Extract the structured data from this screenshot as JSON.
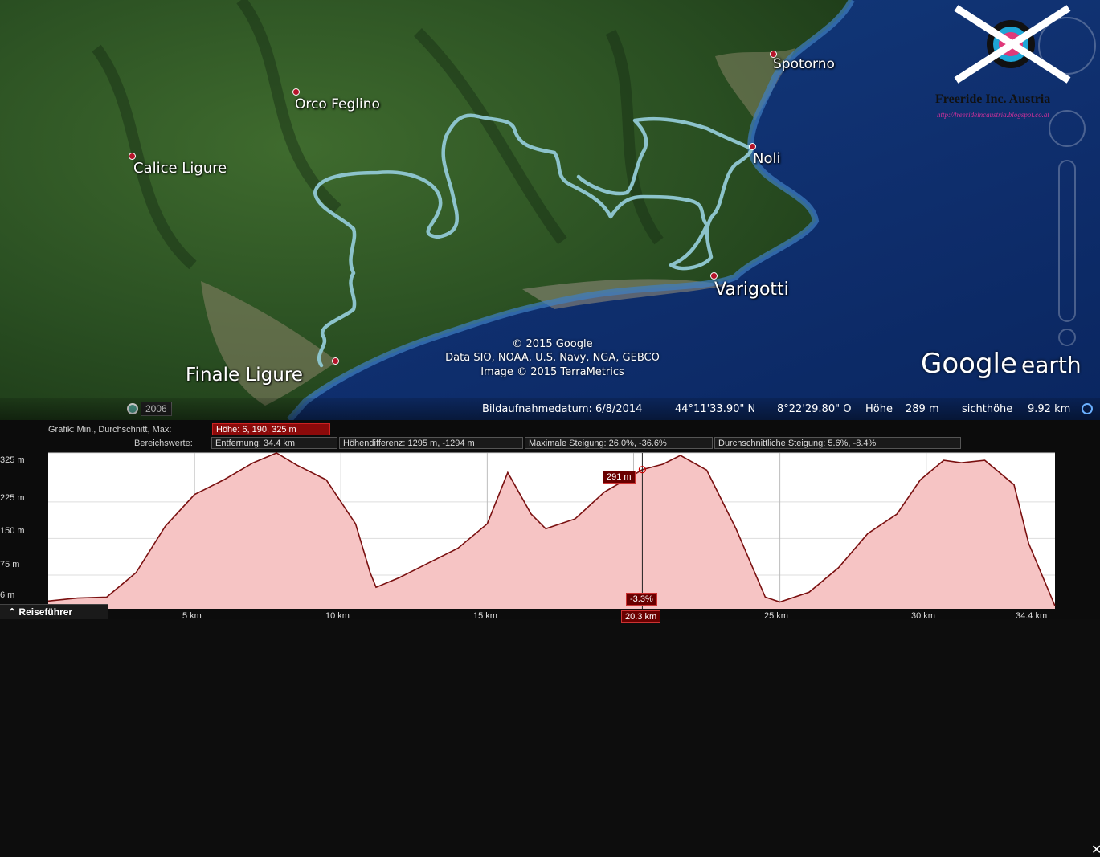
{
  "map": {
    "places": {
      "spotorno": "Spotorno",
      "orco": "Orco Feglino",
      "calice": "Calice Ligure",
      "noli": "Noli",
      "varigotti": "Varigotti",
      "finale": "Finale Ligure"
    },
    "credits": {
      "line1": "© 2015 Google",
      "line2": "Data SIO, NOAA, U.S. Navy, NGA, GEBCO",
      "line3": "Image © 2015 TerraMetrics"
    },
    "logo": {
      "line1": "Google",
      "line2": "earth"
    },
    "watermark": {
      "title": "Freeride Inc. Austria",
      "url": "http://freerideincaustria.blogspot.co.at"
    },
    "year_badge": "2006"
  },
  "statusbar": {
    "date": "Bildaufnahmedatum: 6/8/2014",
    "lat": "44°11'33.90\" N",
    "lon": "8°22'29.80\" O",
    "height_label": "Höhe",
    "height_value": "289 m",
    "eye_label": "sichthöhe",
    "eye_value": "9.92 km"
  },
  "profile": {
    "graph_label": "Grafik: Min., Durchschnitt, Max:",
    "graph_value": "Höhe: 6, 190, 325 m",
    "range_label": "Bereichswerte:",
    "distance": "Entfernung: 34.4 km",
    "elevation_diff": "Höhendifferenz: 1295 m, -1294 m",
    "max_slope": "Maximale Steigung: 26.0%, -36.6%",
    "avg_slope": "Durchschnittliche Steigung: 5.6%, -8.4%",
    "cursor_height": "291 m",
    "cursor_slope": "-3.3%",
    "cursor_distance": "20.3 km",
    "y_ticks": [
      "325 m",
      "225 m",
      "150 m",
      "75 m",
      "6 m"
    ],
    "x_ticks": [
      "5 km",
      "10 km",
      "15 km",
      "25 km",
      "30 km",
      "34.4 km"
    ],
    "tour_button": "Reiseführer"
  },
  "colors": {
    "track": "#7ab4bd",
    "profile_line": "#7a1010",
    "profile_fill": "#f6c4c4",
    "badge_red": "#8c0a0a"
  },
  "chart_data": {
    "type": "area",
    "xlabel": "",
    "ylabel": "",
    "xlim": [
      0,
      34.4
    ],
    "ylim": [
      6,
      325
    ],
    "x": [
      0,
      1,
      2,
      3,
      4,
      5,
      6,
      7,
      7.8,
      8.5,
      9.5,
      10.5,
      11,
      11.2,
      12,
      13,
      14,
      15,
      15.7,
      16.5,
      17,
      18,
      19,
      20,
      20.3,
      21,
      21.6,
      22.5,
      23.5,
      24.5,
      25,
      26,
      27,
      28,
      29,
      29.8,
      30.6,
      31.2,
      32,
      33,
      33.5,
      34.4
    ],
    "series": [
      {
        "values": [
          22,
          28,
          30,
          80,
          175,
          240,
          270,
          305,
          325,
          300,
          270,
          180,
          80,
          50,
          70,
          100,
          130,
          180,
          285,
          200,
          170,
          190,
          245,
          280,
          291,
          302,
          320,
          290,
          170,
          30,
          20,
          40,
          90,
          160,
          200,
          270,
          310,
          305,
          310,
          260,
          140,
          12
        ]
      }
    ]
  }
}
